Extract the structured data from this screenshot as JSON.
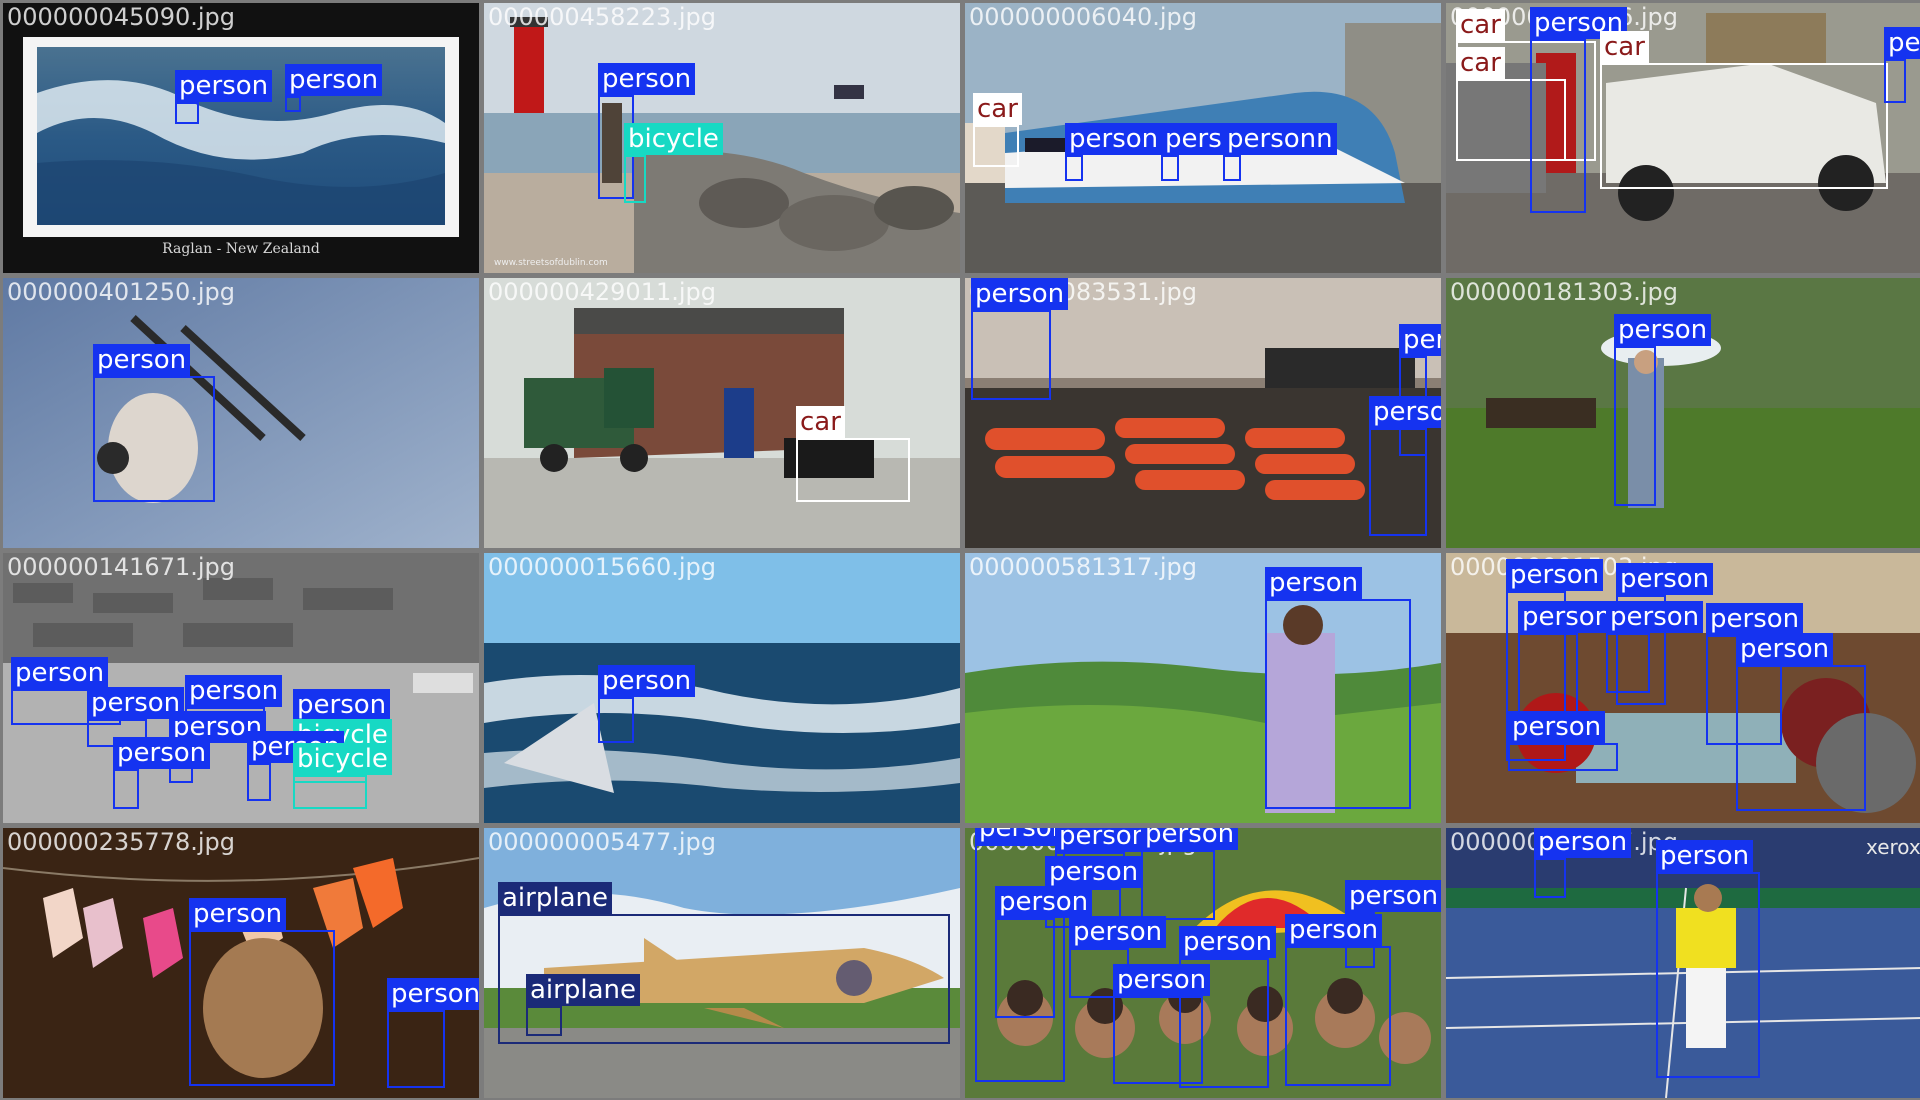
{
  "colors": {
    "person": "#1533f0",
    "bicycle": "#17d9c4",
    "car": "#ffffff",
    "airplane": "#1b2a78",
    "grid_bg": "#7c7c7c"
  },
  "tiles": [
    {
      "filename": "000000045090.jpg",
      "caption": "Raglan - New Zealand",
      "boxes": [
        {
          "label": "person",
          "cls": "c-person"
        },
        {
          "label": "person",
          "cls": "c-person"
        }
      ]
    },
    {
      "filename": "000000458223.jpg",
      "caption": "www.streetsofdublin.com",
      "boxes": [
        {
          "label": "person",
          "cls": "c-person"
        },
        {
          "label": "bicycle",
          "cls": "c-bicycle"
        }
      ]
    },
    {
      "filename": "000000006040.jpg",
      "boxes": [
        {
          "label": "car",
          "cls": "c-car"
        },
        {
          "label": "person",
          "cls": "c-person"
        },
        {
          "label": "person",
          "cls": "c-person"
        },
        {
          "label": "personn",
          "cls": "c-person"
        }
      ]
    },
    {
      "filename": "000000005476.jpg",
      "boxes": [
        {
          "label": "car",
          "cls": "c-car"
        },
        {
          "label": "car",
          "cls": "c-car"
        },
        {
          "label": "person",
          "cls": "c-person"
        },
        {
          "label": "car",
          "cls": "c-car"
        },
        {
          "label": "person",
          "cls": "c-person"
        }
      ]
    },
    {
      "filename": "000000401250.jpg",
      "boxes": [
        {
          "label": "person",
          "cls": "c-person"
        }
      ]
    },
    {
      "filename": "000000429011.jpg",
      "boxes": [
        {
          "label": "car",
          "cls": "c-car"
        }
      ]
    },
    {
      "filename": "000000083531.jpg",
      "boxes": [
        {
          "label": "person",
          "cls": "c-person"
        },
        {
          "label": "person",
          "cls": "c-person"
        },
        {
          "label": "person",
          "cls": "c-person"
        }
      ]
    },
    {
      "filename": "000000181303.jpg",
      "boxes": [
        {
          "label": "person",
          "cls": "c-person"
        }
      ]
    },
    {
      "filename": "000000141671.jpg",
      "boxes": [
        {
          "label": "person",
          "cls": "c-person"
        },
        {
          "label": "person",
          "cls": "c-person"
        },
        {
          "label": "person",
          "cls": "c-person"
        },
        {
          "label": "person",
          "cls": "c-person"
        },
        {
          "label": "person",
          "cls": "c-person"
        },
        {
          "label": "bicycle",
          "cls": "c-bicycle"
        },
        {
          "label": "person",
          "cls": "c-person"
        },
        {
          "label": "person",
          "cls": "c-person"
        },
        {
          "label": "bicycle",
          "cls": "c-bicycle"
        }
      ]
    },
    {
      "filename": "000000015660.jpg",
      "boxes": [
        {
          "label": "person",
          "cls": "c-person"
        }
      ]
    },
    {
      "filename": "000000581317.jpg",
      "boxes": [
        {
          "label": "person",
          "cls": "c-person"
        }
      ]
    },
    {
      "filename": "000000001503.jpg",
      "boxes": [
        {
          "label": "person",
          "cls": "c-person"
        },
        {
          "label": "person",
          "cls": "c-person"
        },
        {
          "label": "person",
          "cls": "c-person"
        },
        {
          "label": "person",
          "cls": "c-person"
        },
        {
          "label": "person",
          "cls": "c-person"
        },
        {
          "label": "person",
          "cls": "c-person"
        },
        {
          "label": "person",
          "cls": "c-person"
        }
      ]
    },
    {
      "filename": "000000235778.jpg",
      "boxes": [
        {
          "label": "person",
          "cls": "c-person"
        },
        {
          "label": "person",
          "cls": "c-person"
        }
      ]
    },
    {
      "filename": "000000005477.jpg",
      "boxes": [
        {
          "label": "airplane",
          "cls": "c-airplane"
        },
        {
          "label": "airplane",
          "cls": "c-airplane"
        }
      ]
    },
    {
      "filename": "000000052507.jpg",
      "boxes": [
        {
          "label": "person",
          "cls": "c-person"
        },
        {
          "label": "person",
          "cls": "c-person"
        },
        {
          "label": "person",
          "cls": "c-person"
        },
        {
          "label": "person",
          "cls": "c-person"
        },
        {
          "label": "person",
          "cls": "c-person"
        },
        {
          "label": "person",
          "cls": "c-person"
        },
        {
          "label": "person",
          "cls": "c-person"
        },
        {
          "label": "person",
          "cls": "c-person"
        },
        {
          "label": "person",
          "cls": "c-person"
        },
        {
          "label": "person",
          "cls": "c-person"
        }
      ]
    },
    {
      "filename": "000000325347.jpg",
      "sponsor": "xerox",
      "boxes": [
        {
          "label": "person",
          "cls": "c-person"
        },
        {
          "label": "person",
          "cls": "c-person"
        }
      ]
    }
  ]
}
